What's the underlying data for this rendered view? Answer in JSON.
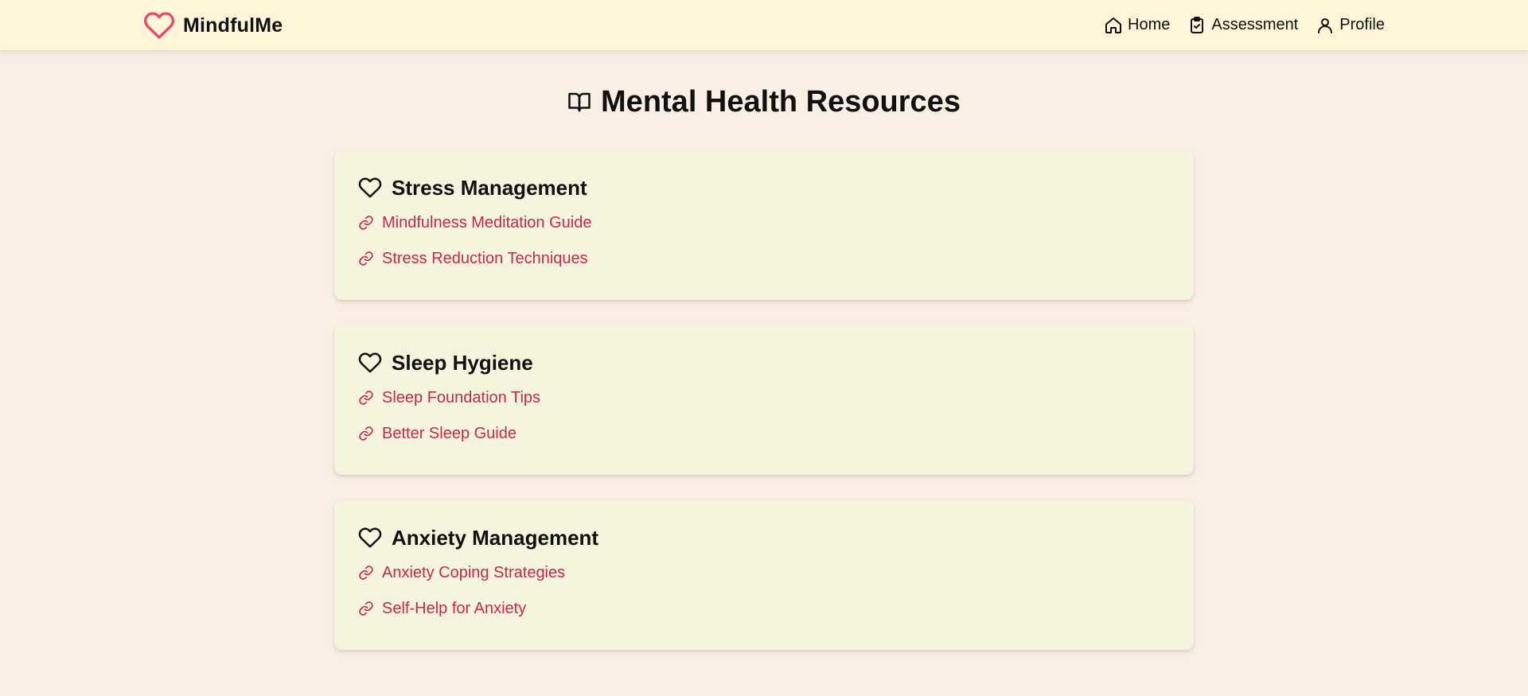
{
  "brand": {
    "name": "MindfulMe",
    "icon": "heart-icon",
    "accent": "#e94a6b"
  },
  "nav": {
    "items": [
      {
        "label": "Home",
        "icon": "home-icon"
      },
      {
        "label": "Assessment",
        "icon": "clipboard-check-icon"
      },
      {
        "label": "Profile",
        "icon": "user-icon"
      }
    ]
  },
  "page": {
    "title": "Mental Health Resources",
    "icon": "book-open-icon"
  },
  "sections": [
    {
      "title": "Stress Management",
      "icon": "heart-icon",
      "links": [
        {
          "label": "Mindfulness Meditation Guide",
          "icon": "link-icon"
        },
        {
          "label": "Stress Reduction Techniques",
          "icon": "link-icon"
        }
      ]
    },
    {
      "title": "Sleep Hygiene",
      "icon": "heart-icon",
      "links": [
        {
          "label": "Sleep Foundation Tips",
          "icon": "link-icon"
        },
        {
          "label": "Better Sleep Guide",
          "icon": "link-icon"
        }
      ]
    },
    {
      "title": "Anxiety Management",
      "icon": "heart-icon",
      "links": [
        {
          "label": "Anxiety Coping Strategies",
          "icon": "link-icon"
        },
        {
          "label": "Self-Help for Anxiety",
          "icon": "link-icon"
        }
      ]
    }
  ],
  "colors": {
    "background": "#f9efe5",
    "navbar": "#fff6d9",
    "card": "#f5f4dc",
    "link": "#c8274f"
  }
}
